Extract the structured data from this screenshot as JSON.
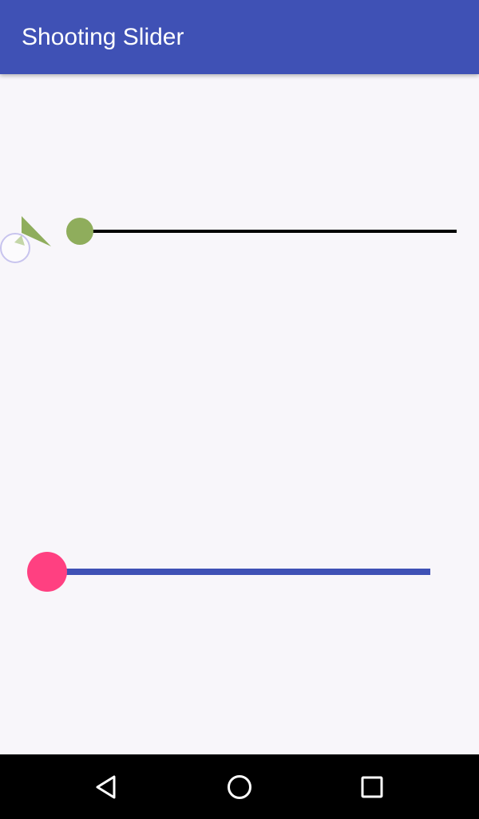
{
  "app_bar": {
    "title": "Shooting Slider",
    "color": "#3f51b5"
  },
  "shooting_slider": {
    "value": 0,
    "thumb_color": "#8fad5c",
    "track_color": "#000000",
    "launcher_icon": "triangle-launcher-icon"
  },
  "standard_slider": {
    "value": 0,
    "thumb_color": "#ff4081",
    "track_color": "#3f51b5"
  },
  "nav_bar": {
    "back_icon": "triangle-back-icon",
    "home_icon": "circle-home-icon",
    "recents_icon": "square-recents-icon"
  }
}
